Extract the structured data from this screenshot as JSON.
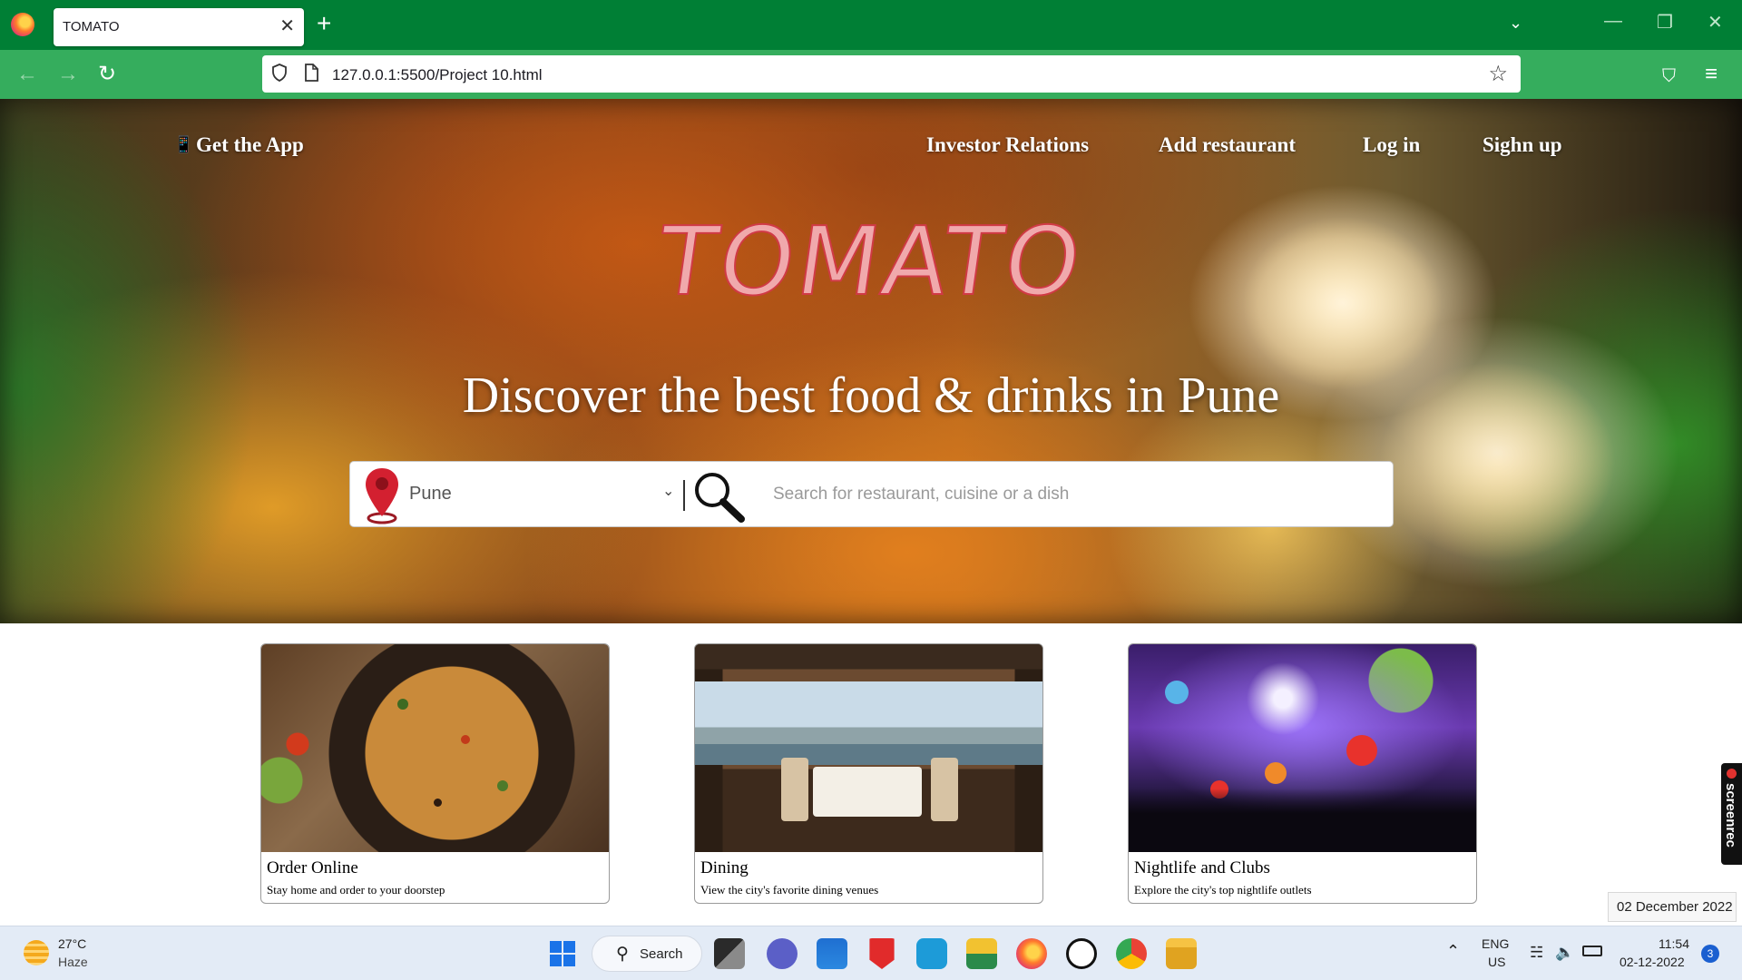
{
  "browser": {
    "tab_title": "TOMATO",
    "tab_close": "✕",
    "new_tab": "+",
    "url": "127.0.0.1:5500/Project 10.html",
    "icons": {
      "back": "←",
      "forward": "→",
      "reload": "↻",
      "tab_list": "⌄",
      "minimize": "—",
      "restore": "❐",
      "close": "✕",
      "star": "☆",
      "pocket": "⛉",
      "menu": "≡"
    }
  },
  "page": {
    "nav": {
      "get_app": "Get the App",
      "links": [
        "Investor Relations",
        "Add restaurant",
        "Log in",
        "Sighn up"
      ]
    },
    "brand": "TOMATO",
    "tagline": "Discover the best food & drinks in Pune",
    "search": {
      "location": "Pune",
      "placeholder": "Search for restaurant, cuisine or a dish"
    },
    "cards": [
      {
        "title": "Order Online",
        "description": "Stay home and order to your doorstep"
      },
      {
        "title": "Dining",
        "description": "View the city's favorite dining venues"
      },
      {
        "title": "Nightlife and Clubs",
        "description": "Explore the city's top nightlife outlets"
      }
    ]
  },
  "overlay": {
    "screenrec_label": "screenrec",
    "date_tooltip": "02 December 2022"
  },
  "taskbar": {
    "weather_temp": "27°C",
    "weather_desc": "Haze",
    "search_label": "Search",
    "language": "ENG",
    "region": "US",
    "time": "11:54",
    "date": "02-12-2022",
    "notifications": "3"
  },
  "colors": {
    "tabbar": "#007f35",
    "navbar": "#35ad5d",
    "brand_fill": "#f0a9ac",
    "brand_stroke": "#d03a45",
    "pin": "#d32030"
  }
}
